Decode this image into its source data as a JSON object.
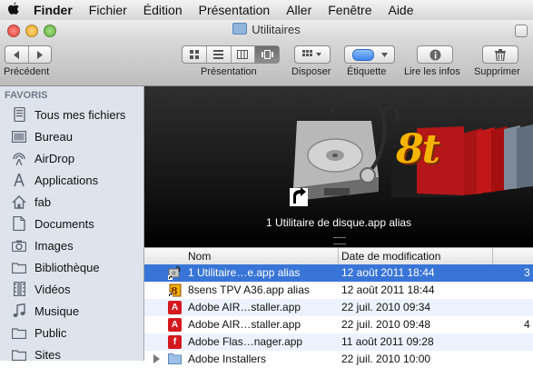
{
  "menubar": {
    "apple_icon": "apple-icon",
    "items": [
      "Finder",
      "Fichier",
      "Édition",
      "Présentation",
      "Aller",
      "Fenêtre",
      "Aide"
    ]
  },
  "window": {
    "title": "Utilitaires",
    "title_icon": "folder-icon"
  },
  "toolbar": {
    "back_label": "Précédent",
    "view_label": "Présentation",
    "arrange_label": "Disposer",
    "label_label": "Étiquette",
    "info_label": "Lire les infos",
    "delete_label": "Supprimer",
    "back_icon": "chevron-left-icon",
    "forward_icon": "chevron-right-icon",
    "view_icons": [
      "icon-view-icon",
      "list-view-icon",
      "column-view-icon",
      "coverflow-view-icon"
    ],
    "arrange_icon": "grid-icon",
    "info_icon": "info-icon",
    "delete_icon": "trash-icon"
  },
  "sidebar": {
    "header": "FAVORIS",
    "items": [
      {
        "label": "Tous mes fichiers",
        "icon": "all-files-icon"
      },
      {
        "label": "Bureau",
        "icon": "desktop-icon"
      },
      {
        "label": "AirDrop",
        "icon": "airdrop-icon"
      },
      {
        "label": "Applications",
        "icon": "applications-icon"
      },
      {
        "label": "fab",
        "icon": "home-icon"
      },
      {
        "label": "Documents",
        "icon": "documents-icon"
      },
      {
        "label": "Images",
        "icon": "camera-icon"
      },
      {
        "label": "Bibliothèque",
        "icon": "folder-icon"
      },
      {
        "label": "Vidéos",
        "icon": "film-icon"
      },
      {
        "label": "Musique",
        "icon": "music-icon"
      },
      {
        "label": "Public",
        "icon": "folder-icon"
      },
      {
        "label": "Sites",
        "icon": "folder-icon"
      }
    ]
  },
  "coverflow": {
    "caption": "1 Utilitaire de disque.app alias",
    "logo_text": "8t"
  },
  "list": {
    "columns": [
      "Nom",
      "Date de modification"
    ],
    "rows": [
      {
        "name": "1 Utilitaire…e.app alias",
        "date": "12 août 2011 18:44",
        "size": "3",
        "icon": "disk-utility-icon",
        "selected": true
      },
      {
        "name": "8sens TPV A36.app alias",
        "date": "12 août 2011 18:44",
        "size": "",
        "icon": "8sens-app-icon",
        "selected": false
      },
      {
        "name": "Adobe AIR…staller.app",
        "date": "22 juil. 2010 09:34",
        "size": "",
        "icon": "adobe-air-icon",
        "selected": false
      },
      {
        "name": "Adobe AIR…staller.app",
        "date": "22 juil. 2010 09:48",
        "size": "4",
        "icon": "adobe-air-icon",
        "selected": false
      },
      {
        "name": "Adobe Flas…nager.app",
        "date": "11 août 2011 09:28",
        "size": "",
        "icon": "adobe-flash-icon",
        "selected": false
      },
      {
        "name": "Adobe Installers",
        "date": "22 juil. 2010 10:00",
        "size": "",
        "icon": "folder-icon",
        "selected": false
      }
    ]
  }
}
